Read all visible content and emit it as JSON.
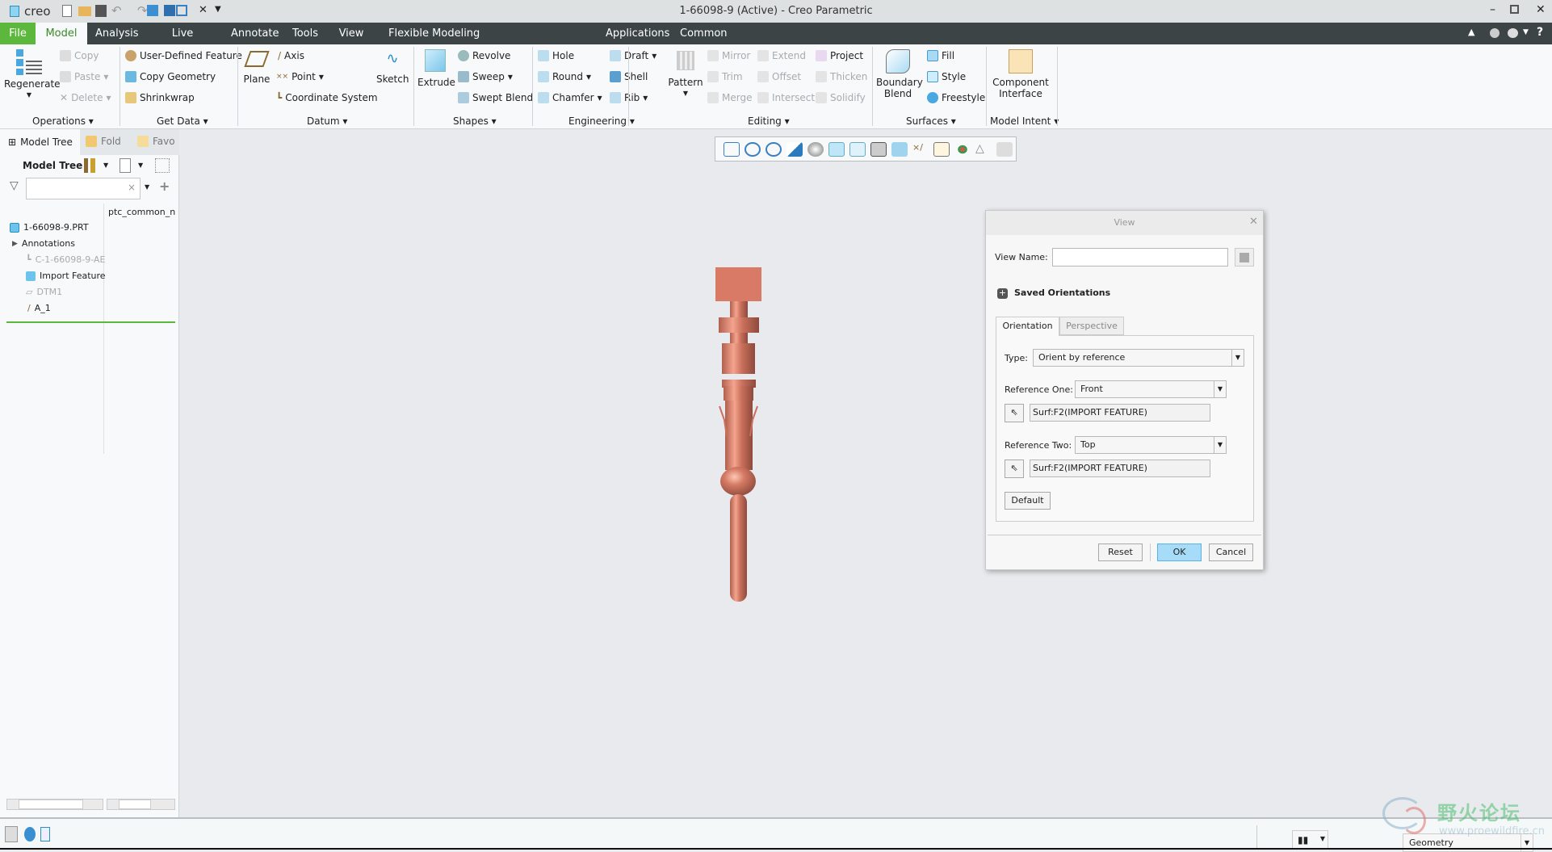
{
  "app": {
    "logo": "creo",
    "title": "1-66098-9 (Active) - Creo Parametric"
  },
  "tabs": [
    "File",
    "Model",
    "Analysis",
    "Live Simulation",
    "Annotate",
    "Tools",
    "View",
    "Flexible Modeling",
    "Applications",
    "Common"
  ],
  "ribbon": {
    "operations": {
      "label": "Operations",
      "regenerate": "Regenerate",
      "copy": "Copy",
      "paste": "Paste",
      "delete": "Delete"
    },
    "get_data": {
      "label": "Get Data",
      "udf": "User-Defined Feature",
      "copy_geometry": "Copy Geometry",
      "shrinkwrap": "Shrinkwrap"
    },
    "datum": {
      "label": "Datum",
      "plane": "Plane",
      "axis": "Axis",
      "point": "Point",
      "csys": "Coordinate System",
      "sketch": "Sketch"
    },
    "shapes": {
      "label": "Shapes",
      "extrude": "Extrude",
      "revolve": "Revolve",
      "sweep": "Sweep",
      "swept_blend": "Swept Blend"
    },
    "engineering": {
      "label": "Engineering",
      "hole": "Hole",
      "round": "Round",
      "chamfer": "Chamfer",
      "draft": "Draft",
      "shell": "Shell",
      "rib": "Rib"
    },
    "editing": {
      "label": "Editing",
      "pattern": "Pattern",
      "mirror": "Mirror",
      "trim": "Trim",
      "merge": "Merge",
      "extend": "Extend",
      "offset": "Offset",
      "intersect": "Intersect",
      "project": "Project",
      "thicken": "Thicken",
      "solidify": "Solidify"
    },
    "surfaces": {
      "label": "Surfaces",
      "boundary_blend_1": "Boundary",
      "boundary_blend_2": "Blend",
      "fill": "Fill",
      "style": "Style",
      "freestyle": "Freestyle"
    },
    "model_intent": {
      "label": "Model Intent",
      "ci_1": "Component",
      "ci_2": "Interface"
    }
  },
  "left_panel": {
    "tabs": [
      "Model Tree",
      "Fold",
      "Favo"
    ],
    "header": "Model Tree",
    "search": {
      "value": "",
      "placeholder": ""
    },
    "column": "ptc_common_n",
    "items": [
      {
        "label": "1-66098-9.PRT",
        "dim": false
      },
      {
        "label": "Annotations",
        "dim": false
      },
      {
        "label": "C-1-66098-9-AE",
        "dim": true
      },
      {
        "label": "Import Feature",
        "dim": false
      },
      {
        "label": "DTM1",
        "dim": true
      },
      {
        "label": "A_1",
        "dim": false
      }
    ]
  },
  "dialog": {
    "title": "View",
    "view_name_label": "View Name:",
    "view_name_value": "",
    "saved_orientations": "Saved Orientations",
    "tabs": [
      "Orientation",
      "Perspective"
    ],
    "type_label": "Type:",
    "type_value": "Orient by reference",
    "ref_one_label": "Reference One:",
    "ref_one_value": "Front",
    "ref_one_surface": "Surf:F2(IMPORT FEATURE)",
    "ref_two_label": "Reference Two:",
    "ref_two_value": "Top",
    "ref_two_surface": "Surf:F2(IMPORT FEATURE)",
    "default": "Default",
    "reset": "Reset",
    "ok": "OK",
    "cancel": "Cancel"
  },
  "status": {
    "filter": "Geometry"
  },
  "watermark": {
    "cn": "野火论坛",
    "url": "www.proewildfire.cn"
  },
  "colors": {
    "file_tab": "#5cb83c",
    "tabbar": "#3c4446",
    "part": "#d87a66",
    "ok": "#a6dcf7"
  }
}
